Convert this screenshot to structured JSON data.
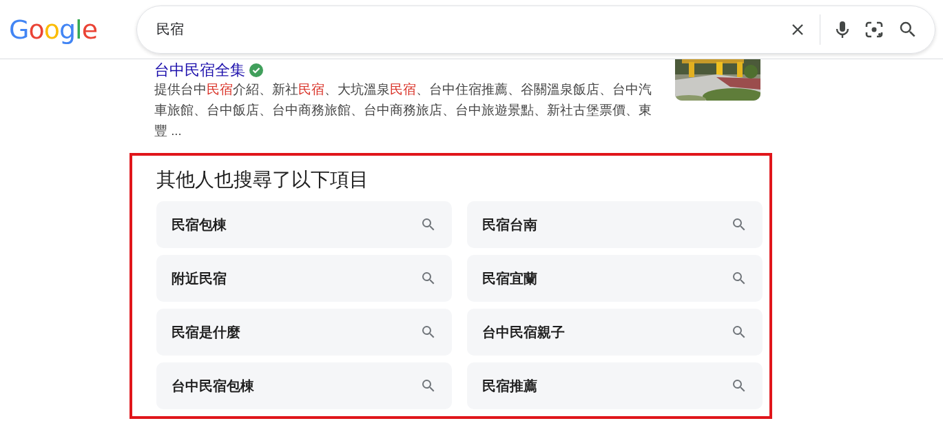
{
  "header": {
    "logo": "Google",
    "search": {
      "value": "民宿"
    }
  },
  "result": {
    "title": "台中民宿全集",
    "verified": true,
    "snippet": [
      {
        "text": "提供台中",
        "match": false
      },
      {
        "text": "民宿",
        "match": true
      },
      {
        "text": "介紹、新社",
        "match": false
      },
      {
        "text": "民宿",
        "match": true
      },
      {
        "text": "、大坑溫泉",
        "match": false
      },
      {
        "text": "民宿",
        "match": true
      },
      {
        "text": "、台中住宿推薦、谷關溫泉飯店、台中汽車旅館、台中飯店、台中商務旅館、台中商務旅店、台中旅遊景點、新社古堡票價、東豐 ...",
        "match": false
      }
    ]
  },
  "related": {
    "highlighted": true,
    "heading": "其他人也搜尋了以下項目",
    "items": [
      "民宿包棟",
      "民宿台南",
      "附近民宿",
      "民宿宜蘭",
      "民宿是什麼",
      "台中民宿親子",
      "台中民宿包棟",
      "民宿推薦"
    ]
  }
}
